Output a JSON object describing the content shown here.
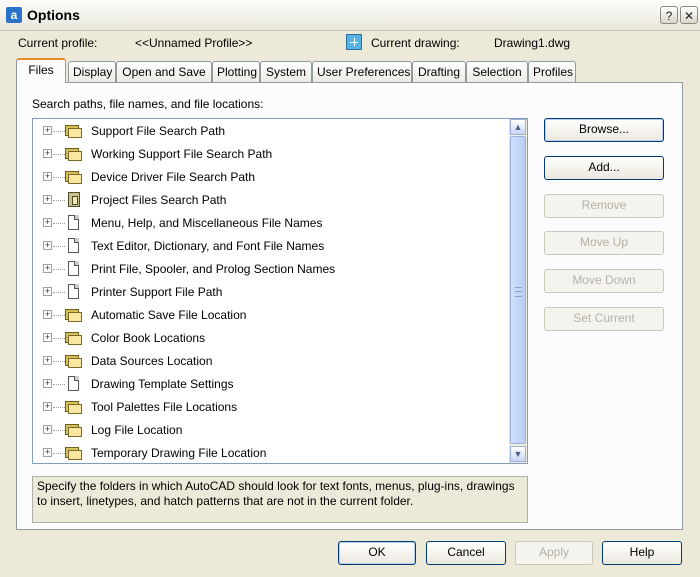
{
  "window": {
    "app_icon_glyph": "a",
    "title": "Options",
    "help_glyph": "?",
    "close_glyph": "✕"
  },
  "profile": {
    "current_profile_label": "Current profile:",
    "current_profile_value": "<<Unnamed Profile>>",
    "current_drawing_label": "Current drawing:",
    "current_drawing_value": "Drawing1.dwg"
  },
  "tabs": [
    {
      "label": "Files",
      "active": true
    },
    {
      "label": "Display"
    },
    {
      "label": "Open and Save"
    },
    {
      "label": "Plotting"
    },
    {
      "label": "System"
    },
    {
      "label": "User Preferences"
    },
    {
      "label": "Drafting"
    },
    {
      "label": "Selection"
    },
    {
      "label": "Profiles"
    }
  ],
  "files": {
    "paths_label": "Search paths, file names, and file locations:",
    "expand_glyph": "+",
    "items": [
      {
        "label": "Support File Search Path",
        "icon": "folder-icon"
      },
      {
        "label": "Working Support File Search Path",
        "icon": "folder-icon"
      },
      {
        "label": "Device Driver File Search Path",
        "icon": "folder-icon"
      },
      {
        "label": "Project Files Search Path",
        "icon": "project-icon"
      },
      {
        "label": "Menu, Help, and Miscellaneous File Names",
        "icon": "document-icon"
      },
      {
        "label": "Text Editor, Dictionary, and Font File Names",
        "icon": "document-icon"
      },
      {
        "label": "Print File, Spooler, and Prolog Section Names",
        "icon": "document-icon"
      },
      {
        "label": "Printer Support File Path",
        "icon": "document-icon"
      },
      {
        "label": "Automatic Save File Location",
        "icon": "folder-icon"
      },
      {
        "label": "Color Book Locations",
        "icon": "folder-icon"
      },
      {
        "label": "Data Sources Location",
        "icon": "folder-icon"
      },
      {
        "label": "Drawing Template Settings",
        "icon": "document-icon"
      },
      {
        "label": "Tool Palettes File Locations",
        "icon": "folder-icon"
      },
      {
        "label": "Log File Location",
        "icon": "folder-icon"
      },
      {
        "label": "Temporary Drawing File Location",
        "icon": "folder-icon"
      }
    ],
    "description": "Specify the folders in which AutoCAD should look for text fonts, menus, plug-ins, drawings to insert, linetypes, and hatch patterns that are not in the current folder.",
    "scroll_up_glyph": "▲",
    "scroll_down_glyph": "▼"
  },
  "side_buttons": {
    "browse": "Browse...",
    "add": "Add...",
    "remove": "Remove",
    "move_up": "Move Up",
    "move_down": "Move Down",
    "set_current": "Set Current"
  },
  "footer_buttons": {
    "ok": "OK",
    "cancel": "Cancel",
    "apply": "Apply",
    "help": "Help"
  }
}
